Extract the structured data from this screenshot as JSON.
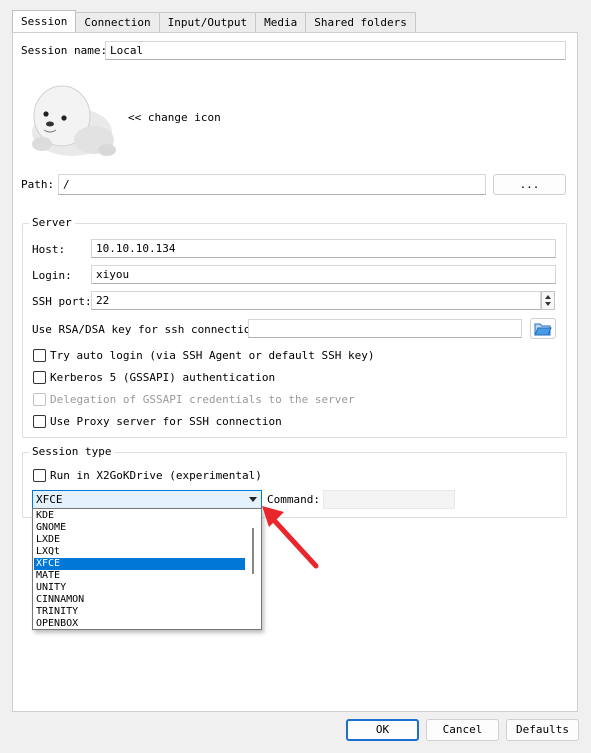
{
  "tabs": [
    "Session",
    "Connection",
    "Input/Output",
    "Media",
    "Shared folders"
  ],
  "session": {
    "name_label": "Session name:",
    "name_value": "Local",
    "change_icon": "<< change icon",
    "path_label": "Path:",
    "path_value": "/",
    "browse_label": "..."
  },
  "server": {
    "title": "Server",
    "host_label": "Host:",
    "host_value": "10.10.10.134",
    "login_label": "Login:",
    "login_value": "xiyou",
    "port_label": "SSH port:",
    "port_value": "22",
    "rsa_label": "Use RSA/DSA key for ssh connection:",
    "rsa_value": "",
    "auto_login": "Try auto login (via SSH Agent or default SSH key)",
    "kerberos": "Kerberos 5 (GSSAPI) authentication",
    "delegation": "Delegation of GSSAPI credentials to the server",
    "proxy": "Use Proxy server for SSH connection"
  },
  "session_type": {
    "title": "Session type",
    "run_drive": "Run in X2GoKDrive (experimental)",
    "selected": "XFCE",
    "command_label": "Command:",
    "options": [
      "KDE",
      "GNOME",
      "LXDE",
      "LXQt",
      "XFCE",
      "MATE",
      "UNITY",
      "CINNAMON",
      "TRINITY",
      "OPENBOX"
    ],
    "selected_index": 4
  },
  "footer": {
    "ok": "OK",
    "cancel": "Cancel",
    "defaults": "Defaults"
  },
  "icons": {
    "seal": "seal-icon",
    "folder": "folder-open-icon",
    "arrow": "red-arrow-annotation"
  },
  "colors": {
    "accent": "#0078d7",
    "annotation": "#e8262b"
  }
}
